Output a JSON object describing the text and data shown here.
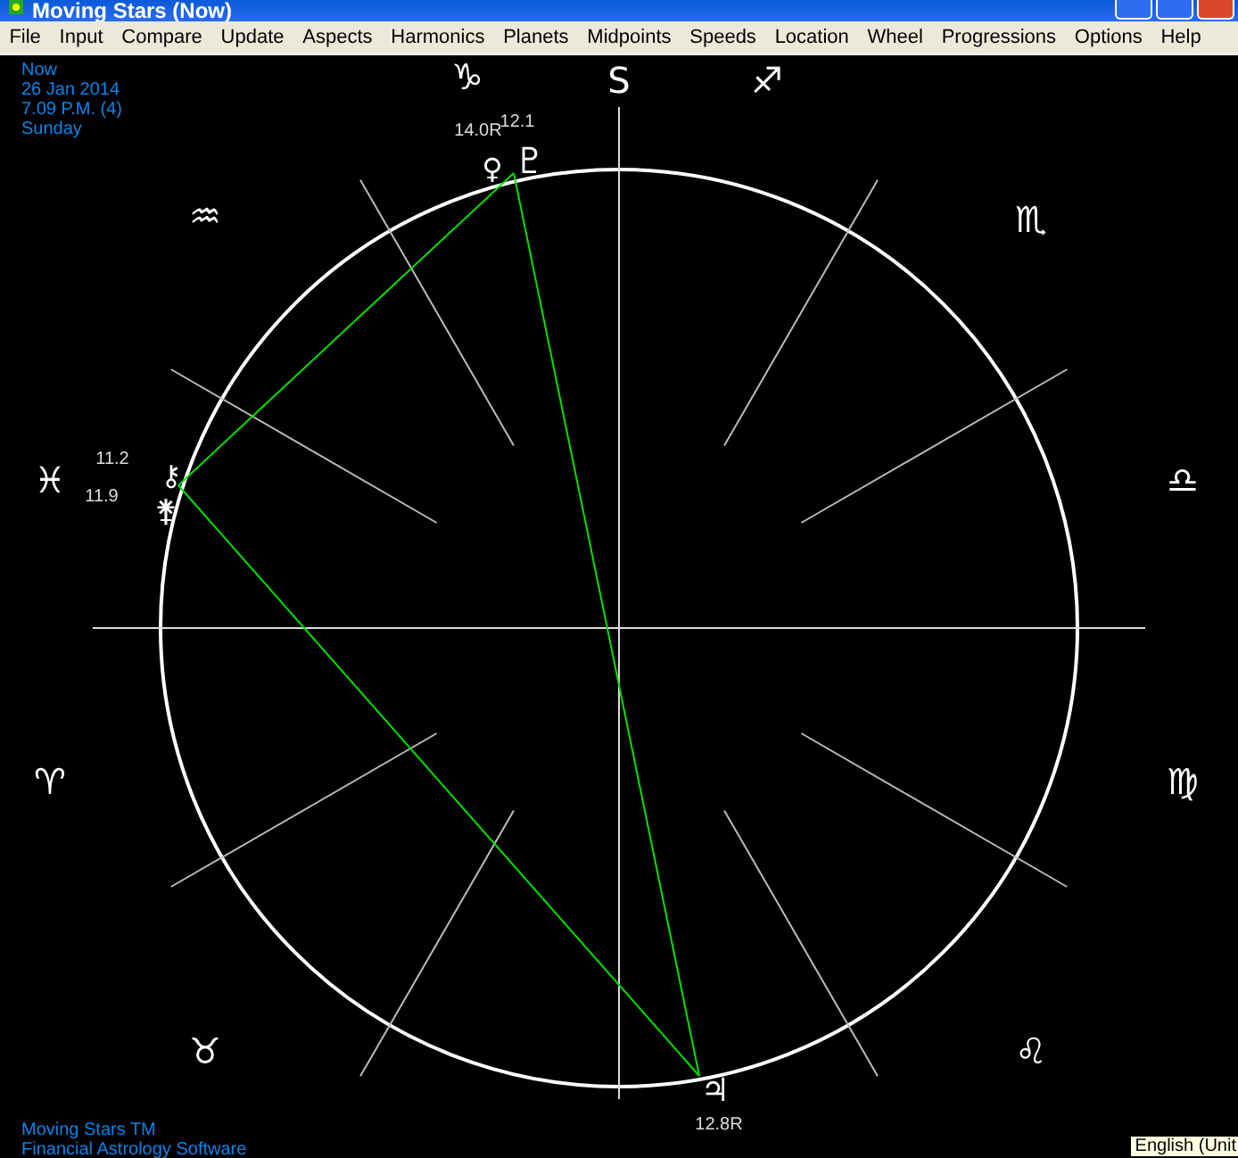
{
  "window": {
    "title": "Moving Stars (Now)"
  },
  "menu": [
    "File",
    "Input",
    "Compare",
    "Update",
    "Aspects",
    "Harmonics",
    "Planets",
    "Midpoints",
    "Speeds",
    "Location",
    "Wheel",
    "Progressions",
    "Options",
    "Help"
  ],
  "info": [
    "Now",
    "26 Jan 2014",
    "7.09 P.M. (4)",
    "Sunday"
  ],
  "wheel": {
    "top_label": "S",
    "signs": [
      "♑",
      "♐",
      "♒",
      "♏",
      "♓",
      "♎",
      "♈",
      "♍",
      "♉",
      "♌"
    ],
    "planets": [
      "♀",
      "♇",
      "⚷",
      "⚵",
      "♃"
    ],
    "readings": [
      "14.0R",
      "12.1",
      "11.2",
      "11.9",
      "12.8R"
    ]
  },
  "footer": [
    "Moving Stars TM",
    "Financial Astrology Software"
  ],
  "language_tooltip": "English (Unit"
}
